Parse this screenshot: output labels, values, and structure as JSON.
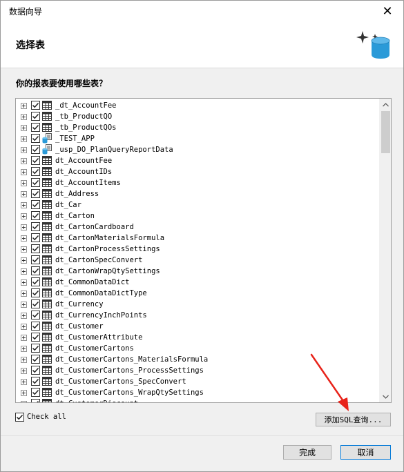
{
  "window": {
    "title": "数据向导",
    "close_glyph": "✕"
  },
  "header": {
    "title": "选择表",
    "icon": "database-sparkle-icon"
  },
  "question": "你的报表要使用哪些表？",
  "tables": [
    {
      "label": "_dt_AccountFee",
      "kind": "table",
      "checked": true
    },
    {
      "label": "_tb_ProductQO",
      "kind": "table",
      "checked": true
    },
    {
      "label": "_tb_ProductQOs",
      "kind": "table",
      "checked": true
    },
    {
      "label": "_TEST_APP",
      "kind": "procedure",
      "checked": true
    },
    {
      "label": "_usp_DO_PlanQueryReportData",
      "kind": "procedure",
      "checked": true
    },
    {
      "label": "dt_AccountFee",
      "kind": "table",
      "checked": true
    },
    {
      "label": "dt_AccountIDs",
      "kind": "table",
      "checked": true
    },
    {
      "label": "dt_AccountItems",
      "kind": "table",
      "checked": true
    },
    {
      "label": "dt_Address",
      "kind": "table",
      "checked": true
    },
    {
      "label": "dt_Car",
      "kind": "table",
      "checked": true
    },
    {
      "label": "dt_Carton",
      "kind": "table",
      "checked": true
    },
    {
      "label": "dt_CartonCardboard",
      "kind": "table",
      "checked": true
    },
    {
      "label": "dt_CartonMaterialsFormula",
      "kind": "table",
      "checked": true
    },
    {
      "label": "dt_CartonProcessSettings",
      "kind": "table",
      "checked": true
    },
    {
      "label": "dt_CartonSpecConvert",
      "kind": "table",
      "checked": true
    },
    {
      "label": "dt_CartonWrapQtySettings",
      "kind": "table",
      "checked": true
    },
    {
      "label": "dt_CommonDataDict",
      "kind": "table",
      "checked": true
    },
    {
      "label": "dt_CommonDataDictType",
      "kind": "table",
      "checked": true
    },
    {
      "label": "dt_Currency",
      "kind": "table",
      "checked": true
    },
    {
      "label": "dt_CurrencyInchPoints",
      "kind": "table",
      "checked": true
    },
    {
      "label": "dt_Customer",
      "kind": "table",
      "checked": true
    },
    {
      "label": "dt_CustomerAttribute",
      "kind": "table",
      "checked": true
    },
    {
      "label": "dt_CustomerCartons",
      "kind": "table",
      "checked": true
    },
    {
      "label": "dt_CustomerCartons_MaterialsFormula",
      "kind": "table",
      "checked": true
    },
    {
      "label": "dt_CustomerCartons_ProcessSettings",
      "kind": "table",
      "checked": true
    },
    {
      "label": "dt_CustomerCartons_SpecConvert",
      "kind": "table",
      "checked": true
    },
    {
      "label": "dt_CustomerCartons_WrapQtySettings",
      "kind": "table",
      "checked": true
    },
    {
      "label": "dt_CustomerDiscount",
      "kind": "table",
      "checked": true
    }
  ],
  "check_all": {
    "label": "Check all",
    "checked": true
  },
  "buttons": {
    "add_sql": "添加SQL查询...",
    "finish": "完成",
    "cancel": "取消"
  },
  "colors": {
    "annotation_arrow": "#e8231a",
    "focus_border": "#0078d7",
    "db_icon": "#2a9ad8"
  }
}
